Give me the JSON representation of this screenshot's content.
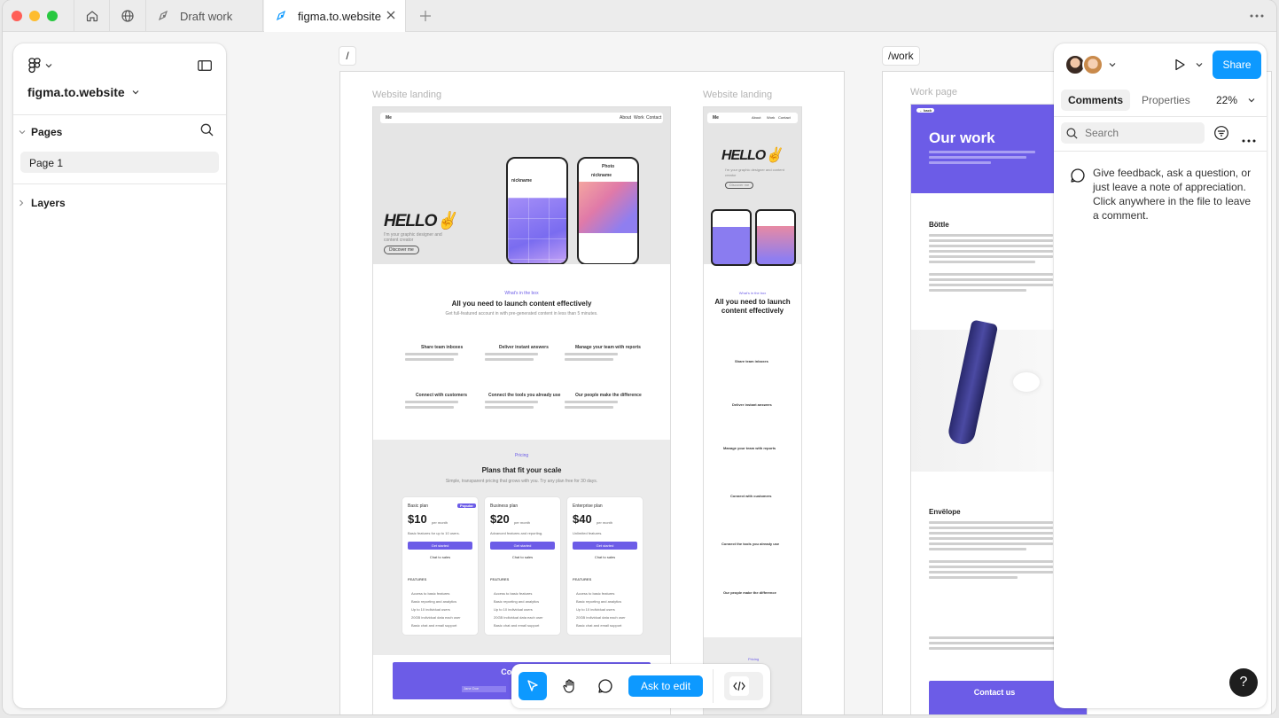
{
  "tabs": {
    "home_icon": "home-icon",
    "globe_icon": "globe-icon",
    "draft": "Draft work",
    "active": "figma.to.website",
    "add_icon": "plus-icon",
    "more_icon": "more-icon"
  },
  "left_panel": {
    "file_name": "figma.to.website",
    "pages_label": "Pages",
    "page_item": "Page 1",
    "layers_label": "Layers"
  },
  "canvas": {
    "tag_root": "/",
    "tag_work": "/work",
    "frame_label_1": "Website landing",
    "frame_label_2": "Website landing",
    "frame_label_3": "Work page"
  },
  "landing": {
    "nav_logo": "Me",
    "nav_links": [
      "About",
      "Work",
      "Contact"
    ],
    "hero_title": "HELLO✌",
    "hero_sub": "I'm your graphic designer and content creator",
    "hero_btn": "Discover me",
    "phone1_name": "nickname",
    "phone2_title": "Photo",
    "phone2_name": "nickname",
    "eyebrow": "What's in the box",
    "section_title": "All you need to launch content effectively",
    "section_sub": "Get full-featured account in with pre-generated content in less than 5 minutes.",
    "features": [
      "Share team inboxes",
      "Deliver instant answers",
      "Manage your team with reports",
      "Connect with customers",
      "Connect the tools you already use",
      "Our people make the difference"
    ],
    "pricing_eyebrow": "Pricing",
    "pricing_title": "Plans that fit your scale",
    "pricing_sub": "Simple, transparent pricing that grows with you. Try any plan free for 30 days.",
    "plans": [
      {
        "name": "Basic plan",
        "price": "$10",
        "per": "per month",
        "desc": "Basic features for up to 10 users.",
        "badge": "Popular"
      },
      {
        "name": "Business plan",
        "price": "$20",
        "per": "per month",
        "desc": "Advanced features and reporting."
      },
      {
        "name": "Enterprise plan",
        "price": "$40",
        "per": "per month",
        "desc": "Unlimited features."
      }
    ],
    "get_started": "Get started",
    "chat_sales": "Chat to sales",
    "features_label": "FEATURES",
    "plan_feature_items": [
      "Access to basic features",
      "Basic reporting and analytics",
      "Up to 10 individual users",
      "20GB individual data each user",
      "Basic chat and email support"
    ],
    "contact_title": "Contact us",
    "contact_field": "Jane Doe"
  },
  "work": {
    "back": "← back",
    "title": "Our work",
    "product1": "Böttle",
    "product2": "Envëlope",
    "contact_title": "Contact us"
  },
  "toolbar": {
    "move_icon": "cursor-icon",
    "hand_icon": "hand-icon",
    "comment_icon": "comment-icon",
    "ask": "Ask to edit",
    "code_icon": "code-icon"
  },
  "right_panel": {
    "share": "Share",
    "tab_comments": "Comments",
    "tab_properties": "Properties",
    "zoom": "22%",
    "search_placeholder": "Search",
    "empty_text": "Give feedback, ask a question, or just leave a note of appreciation. Click anywhere in the file to leave a comment.",
    "help": "?"
  },
  "colors": {
    "accent": "#0d99ff",
    "purple": "#6c5ce7",
    "share": "#0d99ff"
  }
}
